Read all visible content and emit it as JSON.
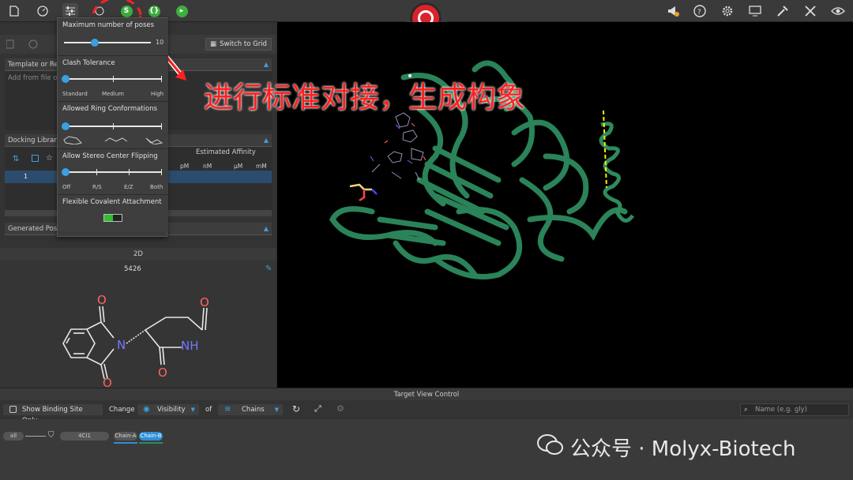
{
  "app": {
    "viewer_label": "2D"
  },
  "toolbar": {
    "left_icons": [
      "file-icon",
      "gauge-icon",
      "sliders-icon",
      "s-step-icon",
      "s-circle-icon",
      "bracket-icon",
      "arrow-circle-icon"
    ],
    "right_icons": [
      "megaphone-icon",
      "help-icon",
      "settings-icon",
      "monitor-icon",
      "tools-icon",
      "tools-2-icon",
      "eye-icon"
    ]
  },
  "left_panel": {
    "switch_to_grid": "Switch to Grid",
    "template_section": "Template or Ref",
    "template_placeholder": "Add from file or",
    "docking_section": "Docking Library",
    "estimated_affinity": "Estimated Affinity",
    "units": [
      "pM",
      "nM",
      "μM",
      "mM"
    ],
    "row_index": "1",
    "generated_section": "Generated Pose"
  },
  "dropdown": {
    "max_poses_title": "Maximum number of poses",
    "max_poses_value": "10",
    "max_poses_fraction": 0.35,
    "clash_title": "Clash Tolerance",
    "clash_labels": [
      "Standard",
      "Medium",
      "High"
    ],
    "ring_title": "Allowed Ring Conformations",
    "stereo_title": "Allow Stereo Center Flipping",
    "stereo_labels": [
      "Off",
      "R/S",
      "E/Z",
      "Both"
    ],
    "covalent_title": "Flexible Covalent Attachment"
  },
  "panel_2d": {
    "header": "2D",
    "compound_id": "5426",
    "atoms": {
      "o1": "O",
      "o2": "O",
      "o3": "O",
      "o4": "O",
      "n1": "N",
      "nh": "NH"
    }
  },
  "annotation": {
    "text": "进行标准对接，生成构象"
  },
  "target_view": {
    "header": "Target View Control",
    "show_binding_site": "Show Binding Site Only",
    "change": "Change",
    "visibility": "Visibility",
    "of": "of",
    "chains": "Chains",
    "name_placeholder": "Name (e.g. gly)",
    "chip_all": "all",
    "chip_pdb": "4CI1",
    "chip_chain_a": "Chain-A",
    "chip_chain_b": "Chain-B"
  },
  "watermark": {
    "text": "公众号 · Molyx-Biotech"
  },
  "colors": {
    "accent": "#3aa0e0",
    "protein": "#2e8b5e",
    "annotation": "#ff2020",
    "logo": "#d8242b"
  }
}
